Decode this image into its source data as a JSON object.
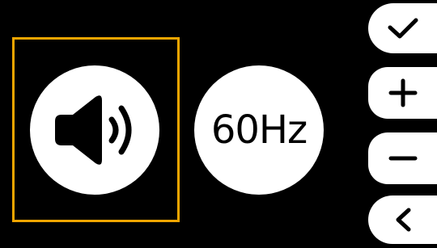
{
  "main": {
    "volume_button": {
      "icon": "speaker-volume-icon",
      "selected": true
    },
    "frequency_button": {
      "label": "60Hz"
    }
  },
  "side_menu": {
    "confirm": {
      "icon": "checkmark-icon"
    },
    "increase": {
      "icon": "plus-icon"
    },
    "decrease": {
      "icon": "minus-icon"
    },
    "back": {
      "icon": "chevron-left-icon"
    }
  },
  "colors": {
    "background": "#000000",
    "button": "#ffffff",
    "selection": "#f0a500"
  }
}
